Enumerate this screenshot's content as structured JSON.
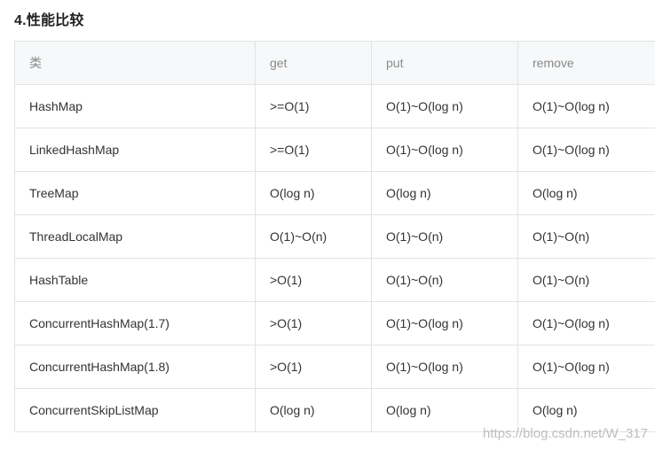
{
  "section": {
    "title": "4.性能比较"
  },
  "table": {
    "headers": [
      "类",
      "get",
      "put",
      "remove"
    ],
    "rows": [
      [
        "HashMap",
        ">=O(1)",
        "O(1)~O(log n)",
        "O(1)~O(log n)"
      ],
      [
        "LinkedHashMap",
        ">=O(1)",
        "O(1)~O(log n)",
        "O(1)~O(log n)"
      ],
      [
        "TreeMap",
        "O(log n)",
        "O(log n)",
        "O(log n)"
      ],
      [
        "ThreadLocalMap",
        "O(1)~O(n)",
        "O(1)~O(n)",
        "O(1)~O(n)"
      ],
      [
        "HashTable",
        ">O(1)",
        "O(1)~O(n)",
        "O(1)~O(n)"
      ],
      [
        "ConcurrentHashMap(1.7)",
        ">O(1)",
        "O(1)~O(log n)",
        "O(1)~O(log n)"
      ],
      [
        "ConcurrentHashMap(1.8)",
        ">O(1)",
        "O(1)~O(log n)",
        "O(1)~O(log n)"
      ],
      [
        "ConcurrentSkipListMap",
        "O(log n)",
        "O(log n)",
        "O(log n)"
      ]
    ]
  },
  "watermark": {
    "text": "https://blog.csdn.net/W_317"
  }
}
